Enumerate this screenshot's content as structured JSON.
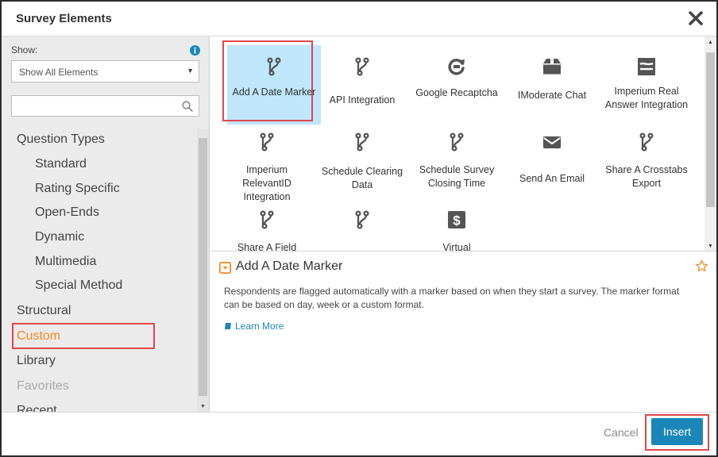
{
  "dialog": {
    "title": "Survey Elements"
  },
  "sidebar": {
    "show_label": "Show:",
    "select_value": "Show All Elements",
    "search_placeholder": "",
    "nav": {
      "question_types": "Question Types",
      "standard": "Standard",
      "rating_specific": "Rating Specific",
      "open_ends": "Open-Ends",
      "dynamic": "Dynamic",
      "multimedia": "Multimedia",
      "special_method": "Special Method",
      "structural": "Structural",
      "custom": "Custom",
      "library": "Library",
      "favorites": "Favorites",
      "recent": "Recent"
    }
  },
  "grid": {
    "tiles": [
      {
        "label": "Add A Date Marker",
        "icon": "branch-icon",
        "selected": true
      },
      {
        "label": "API Integration",
        "icon": "branch-icon"
      },
      {
        "label": "Google Recaptcha",
        "icon": "recaptcha-icon"
      },
      {
        "label": "IModerate Chat",
        "icon": "chat-box-icon"
      },
      {
        "label": "Imperium Real Answer Integration",
        "icon": "imperium-icon"
      },
      {
        "label": "Imperium RelevantID Integration",
        "icon": "branch-icon"
      },
      {
        "label": "Schedule Clearing Data",
        "icon": "branch-icon"
      },
      {
        "label": "Schedule Survey Closing Time",
        "icon": "branch-icon"
      },
      {
        "label": "Send An Email",
        "icon": "envelope-icon"
      },
      {
        "label": "Share A Crosstabs Export",
        "icon": "branch-icon"
      },
      {
        "label": "Share A Field",
        "icon": "branch-icon"
      },
      {
        "label": "",
        "icon": "branch-icon"
      },
      {
        "label": "Virtual",
        "icon": "dollar-icon"
      }
    ]
  },
  "detail": {
    "title": "Add A Date Marker",
    "description": "Respondents are flagged automatically with a marker based on when they start a survey. The marker format can be based on day, week or a custom format.",
    "learn_more": "Learn More"
  },
  "footer": {
    "cancel_label": "Cancel",
    "insert_label": "Insert"
  },
  "colors": {
    "accent": "#1a87b8",
    "custom": "#f08a24",
    "highlight": "#e0474c",
    "selected_tile": "#bfe6fb"
  }
}
